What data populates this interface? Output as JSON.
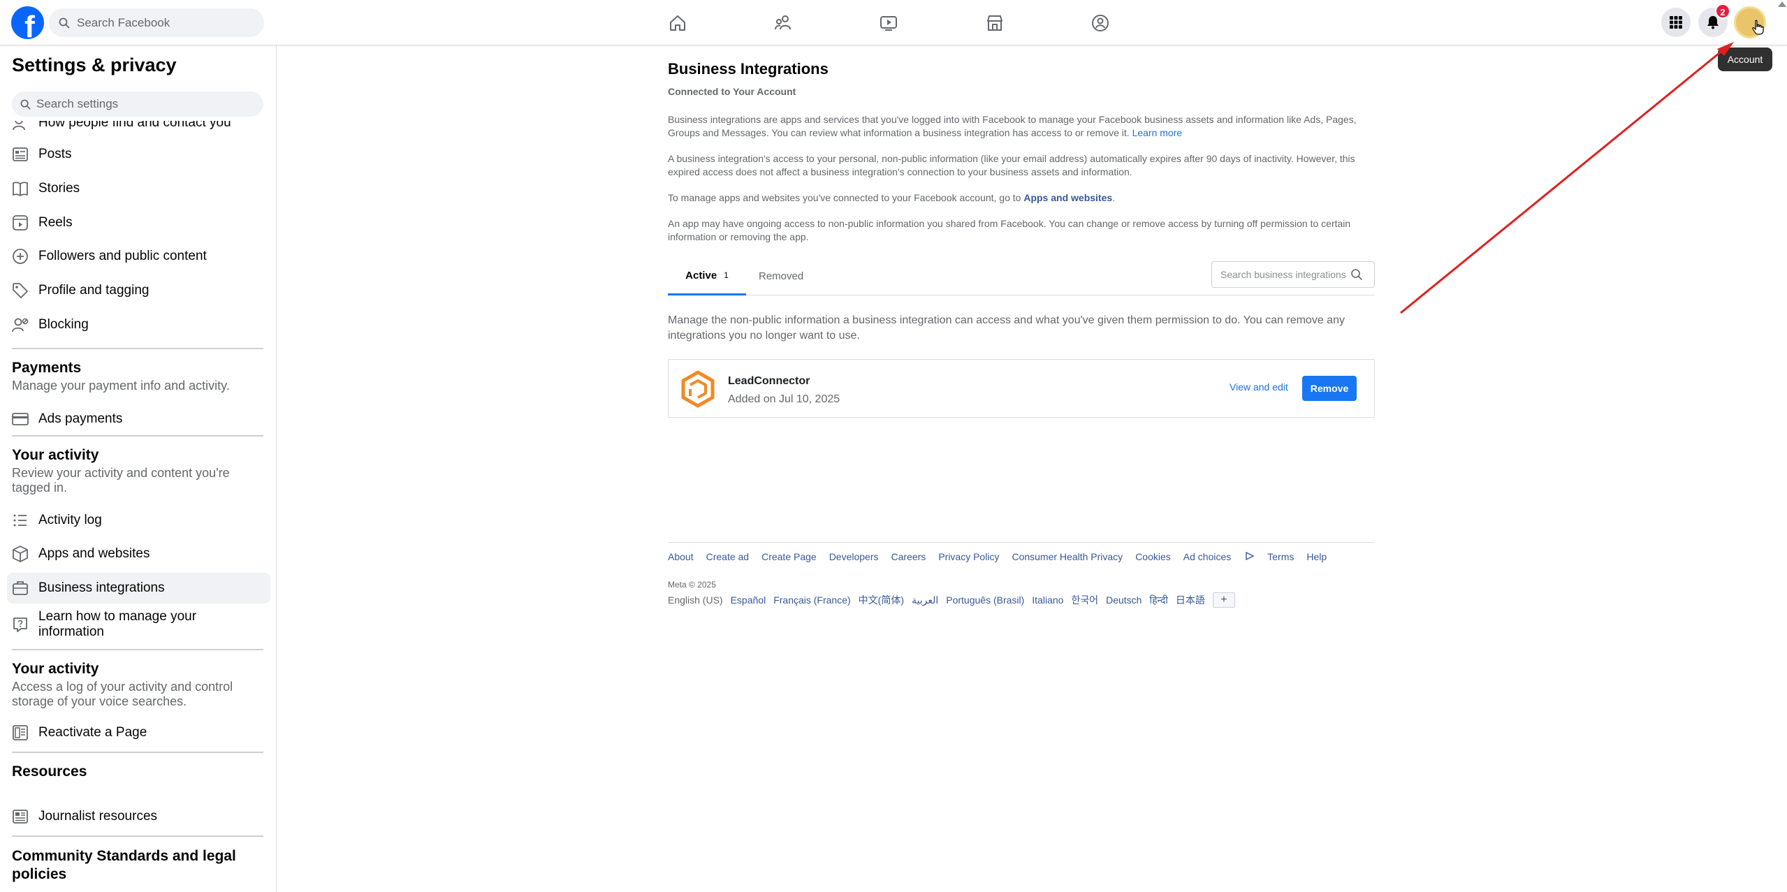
{
  "topbar": {
    "logo_letter": "f",
    "search_placeholder": "Search Facebook",
    "notifications_count": "2",
    "account_tooltip": "Account"
  },
  "sidebar": {
    "title": "Settings & privacy",
    "search_placeholder": "Search settings",
    "items": [
      {
        "label": "How people find and contact you",
        "icon": "person-search-icon"
      },
      {
        "label": "Posts",
        "icon": "posts-icon"
      },
      {
        "label": "Stories",
        "icon": "book-icon"
      },
      {
        "label": "Reels",
        "icon": "reels-icon"
      },
      {
        "label": "Followers and public content",
        "icon": "followers-icon"
      },
      {
        "label": "Profile and tagging",
        "icon": "tag-icon"
      },
      {
        "label": "Blocking",
        "icon": "block-user-icon"
      }
    ],
    "payments": {
      "heading": "Payments",
      "description": "Manage your payment info and activity.",
      "items": [
        {
          "label": "Ads payments",
          "icon": "card-icon"
        }
      ]
    },
    "activity": {
      "heading": "Your activity",
      "description": "Review your activity and content you're tagged in.",
      "items": [
        {
          "label": "Activity log",
          "icon": "list-icon"
        },
        {
          "label": "Apps and websites",
          "icon": "cube-icon"
        },
        {
          "label": "Business integrations",
          "icon": "briefcase-icon"
        },
        {
          "label": "Learn how to manage your information",
          "icon": "help-icon"
        }
      ]
    },
    "activity2": {
      "heading": "Your activity",
      "description": "Access a log of your activity and control storage of your voice searches.",
      "items": [
        {
          "label": "Reactivate a Page",
          "icon": "page-icon"
        }
      ]
    },
    "resources": {
      "heading": "Resources",
      "items": [
        {
          "label": "Journalist resources",
          "icon": "news-icon"
        }
      ]
    },
    "community": {
      "heading": "Community Standards and legal policies"
    }
  },
  "main": {
    "title": "Business Integrations",
    "subtitle": "Connected to Your Account",
    "para1": "Business integrations are apps and services that you've logged into with Facebook to manage your Facebook business assets and information like Ads, Pages, Groups and Messages. You can review what information a business integration has access to or remove it.",
    "learn_more": "Learn more",
    "para2": "A business integration's access to your personal, non-public information (like your email address) automatically expires after 90 days of inactivity. However, this expired access does not affect a business integration's connection to your business assets and information.",
    "para3_prefix": "To manage apps and websites you've connected to your Facebook account, go to",
    "para3_link": "Apps and websites",
    "para3_suffix": ".",
    "para4": "An app may have ongoing access to non-public information you shared from Facebook. You can change or remove access by turning off permission to certain information or removing the app.",
    "tabs": {
      "active_label": "Active",
      "active_count": "1",
      "removed_label": "Removed"
    },
    "search_placeholder": "Search business integrations",
    "manage_text": "Manage the non-public information a business integration can access and what you've given them permission to do. You can remove any integrations you no longer want to use.",
    "integration": {
      "name": "LeadConnector",
      "added": "Added on Jul 10, 2025",
      "view_edit": "View and edit",
      "remove": "Remove"
    }
  },
  "footer": {
    "links": [
      "About",
      "Create ad",
      "Create Page",
      "Developers",
      "Careers",
      "Privacy Policy",
      "Consumer Health Privacy",
      "Cookies",
      "Ad choices",
      "Terms",
      "Help"
    ],
    "copyright": "Meta © 2025",
    "languages": [
      "English (US)",
      "Español",
      "Français (France)",
      "中文(简体)",
      "العربية",
      "Português (Brasil)",
      "Italiano",
      "한국어",
      "Deutsch",
      "हिन्दी",
      "日本語"
    ],
    "more_languages": "+"
  },
  "colors": {
    "brand": "#0866ff",
    "link": "#216fdb",
    "button": "#1877f2",
    "badge": "#e41e3f",
    "annotation_arrow": "#e02020",
    "integration_logo": "#f08a24"
  }
}
